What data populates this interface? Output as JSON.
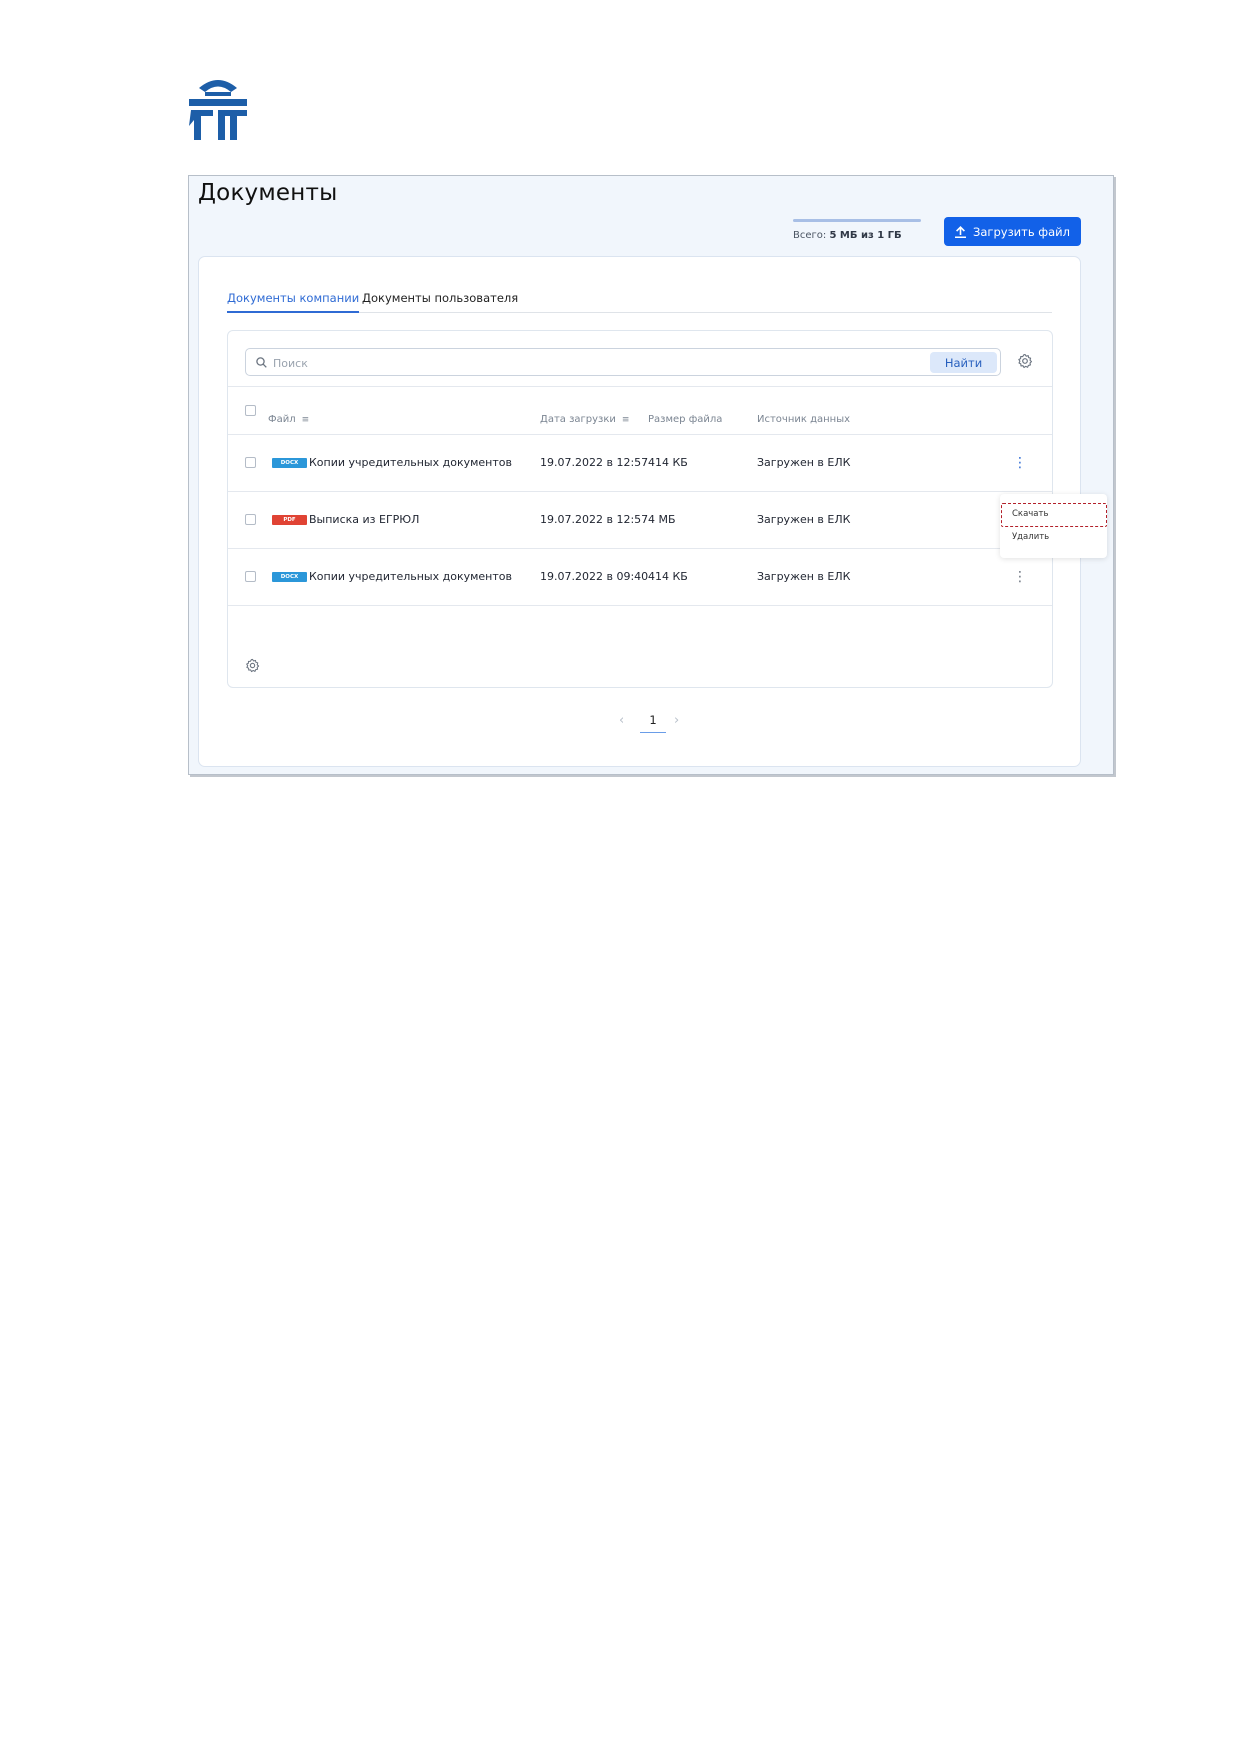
{
  "page": {
    "title": "Документы",
    "quota": {
      "label": "Всего:",
      "value": "5 МБ из 1 ГБ",
      "fill_fraction": 1.0
    },
    "upload_button": "Загрузить файл"
  },
  "tabs": [
    {
      "label": "Документы компании",
      "active": true
    },
    {
      "label": "Документы пользователя",
      "active": false
    }
  ],
  "search": {
    "placeholder": "Поиск",
    "button": "Найти"
  },
  "table": {
    "columns": [
      "Файл",
      "Дата загрузки",
      "Размер файла",
      "Источник данных"
    ],
    "rows": [
      {
        "type": "DOCX",
        "type_color": "#2b97d9",
        "name": "Копии учредительных документов",
        "date": "19.07.2022 в 12:57",
        "size": "414 КБ",
        "source": "Загружен в ЕЛК"
      },
      {
        "type": "PDF",
        "type_color": "#e04334",
        "name": "Выписка из ЕГРЮЛ",
        "date": "19.07.2022 в 12:57",
        "size": "4 МБ",
        "source": "Загружен в ЕЛК"
      },
      {
        "type": "DOCX",
        "type_color": "#2b97d9",
        "name": "Копии учредительных документов",
        "date": "19.07.2022 в 09:40",
        "size": "414 КБ",
        "source": "Загружен в ЕЛК"
      }
    ]
  },
  "pagination": {
    "current": "1",
    "prev_icon": "chevron-left-icon",
    "next_icon": "chevron-right-icon"
  },
  "context_menu": {
    "items": [
      "Скачать",
      "Удалить"
    ],
    "highlighted": "Скачать"
  },
  "colors": {
    "accent": "#1261e8",
    "link": "#2f6bd4",
    "highlight": "#b3202a",
    "logo": "#1d5ea8"
  }
}
